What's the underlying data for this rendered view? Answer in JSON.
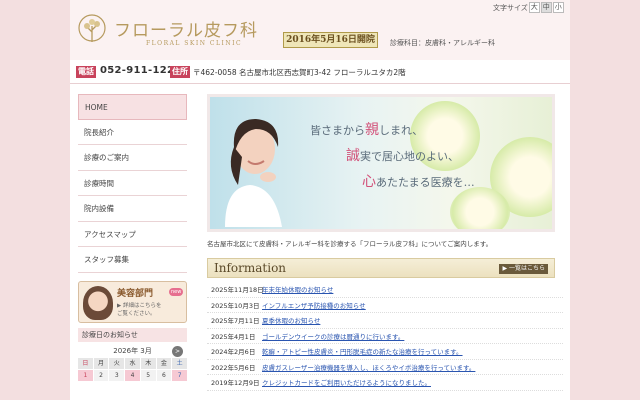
{
  "header": {
    "logo_jp": "フローラル皮フ科",
    "logo_en": "FLORAL SKIN CLINIC",
    "open_badge": "2016年5月16日開院",
    "departments": "診療科目：皮膚科・アレルギー科",
    "font_size": {
      "label": "文字サイズ",
      "options": [
        "大",
        "中",
        "小"
      ],
      "selected": "中"
    }
  },
  "contact": {
    "phone_tag": "電話",
    "phone": "052-911-1222",
    "address_tag": "住所",
    "address": "〒462-0058 名古屋市北区西志賀町3-42 フローラルユタカ2階"
  },
  "sidebar": {
    "items": [
      {
        "label": "HOME"
      },
      {
        "label": "院長紹介"
      },
      {
        "label": "診療のご案内"
      },
      {
        "label": "診療時間"
      },
      {
        "label": "院内設備"
      },
      {
        "label": "アクセスマップ"
      },
      {
        "label": "スタッフ募集"
      }
    ],
    "beauty_banner": {
      "title": "美容部門",
      "badge": "new",
      "line1": "▶ 詳細はこちらを",
      "line2": "ご覧ください。"
    },
    "notice_title": "診療日のお知らせ",
    "calendar": {
      "month": "2026年 3月",
      "next": ">",
      "weekdays": [
        "日",
        "月",
        "火",
        "水",
        "木",
        "金",
        "土"
      ],
      "days": [
        "1",
        "2",
        "3",
        "4",
        "5",
        "6",
        "7"
      ]
    }
  },
  "hero": {
    "line1_pre": "皆さまから",
    "line1_em": "親",
    "line1_post": "しまれ、",
    "line2_em": "誠",
    "line2_post": "実で居心地のよい、",
    "line3_em": "心",
    "line3_post": "あたたまる医療を…"
  },
  "intro": "名古屋市北区にて皮膚科・アレルギー科を診療する「フローラル皮フ科」についてご案内します。",
  "information": {
    "title": "Information",
    "more": "▶ 一覧はこちら",
    "items": [
      {
        "date": "2025年11月18日",
        "text": "年末年始休暇のお知らせ"
      },
      {
        "date": "2025年10月3日",
        "text": "インフルエンザ予防接種のお知らせ"
      },
      {
        "date": "2025年7月11日",
        "text": "夏季休暇のお知らせ"
      },
      {
        "date": "2025年4月1日",
        "text": "ゴールデンウイークの診療は暦通りに行います。"
      },
      {
        "date": "2024年2月6日",
        "text": "乾癬・アトピー性皮膚炎・円形脱毛症の新たな治療を行っています。"
      },
      {
        "date": "2022年5月6日",
        "text": "皮膚ガスレーザー治療機器を導入し、ほくろやイボ治療を行っています。"
      },
      {
        "date": "2019年12月9日",
        "text": "クレジットカードをご利用いただけるようになりました。"
      }
    ]
  },
  "colors": {
    "accent": "#c8435c",
    "gold": "#b69a5e",
    "link": "#2a55b0"
  }
}
